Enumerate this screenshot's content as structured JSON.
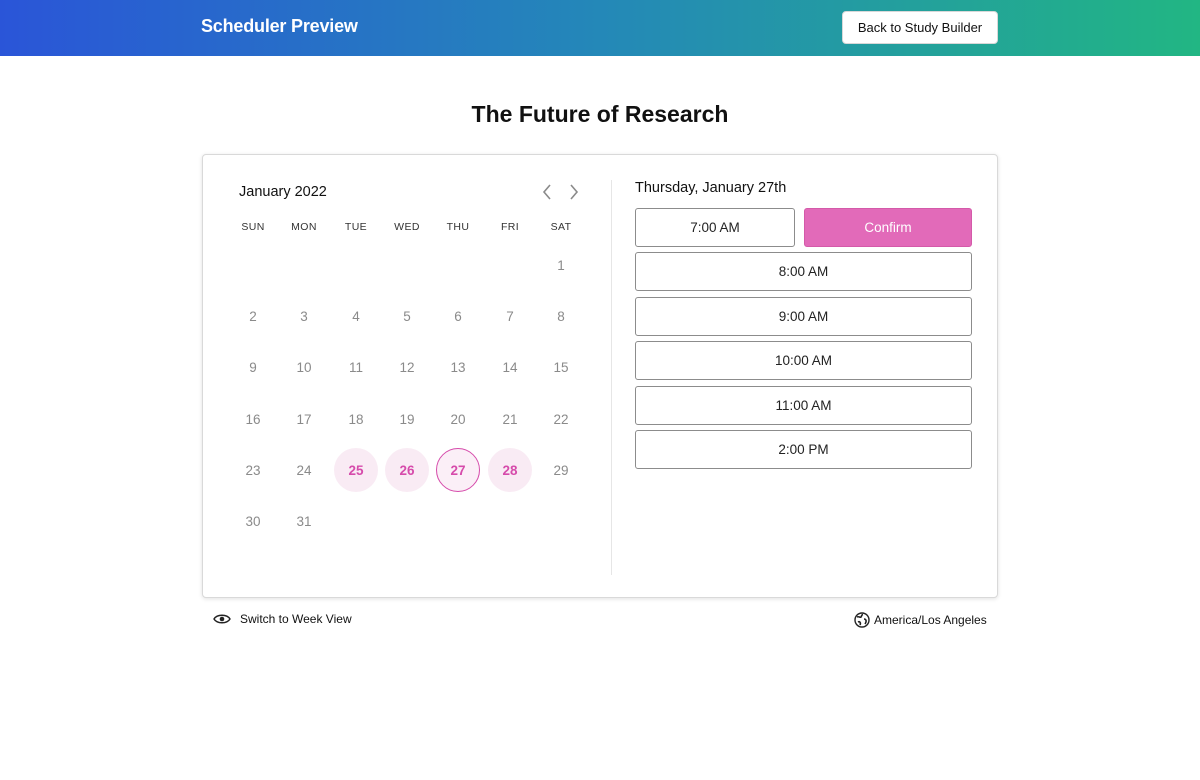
{
  "header": {
    "title": "Scheduler Preview",
    "back_button": "Back to Study Builder"
  },
  "page": {
    "title": "The Future of Research"
  },
  "calendar": {
    "month_label": "January 2022",
    "weekdays": [
      "SUN",
      "MON",
      "TUE",
      "WED",
      "THU",
      "FRI",
      "SAT"
    ],
    "days": [
      "1",
      "2",
      "3",
      "4",
      "5",
      "6",
      "7",
      "8",
      "9",
      "10",
      "11",
      "12",
      "13",
      "14",
      "15",
      "16",
      "17",
      "18",
      "19",
      "20",
      "21",
      "22",
      "23",
      "24",
      "25",
      "26",
      "27",
      "28",
      "29",
      "30",
      "31"
    ],
    "available_days": [
      "25",
      "26",
      "27",
      "28"
    ],
    "selected_day": "27",
    "icons": {
      "prev": "chevron-left-icon",
      "next": "chevron-right-icon"
    }
  },
  "slots": {
    "date_label": "Thursday, January 27th",
    "times": [
      "7:00 AM",
      "8:00 AM",
      "9:00 AM",
      "10:00 AM",
      "11:00 AM",
      "2:00 PM"
    ],
    "selected_time": "7:00 AM",
    "confirm_label": "Confirm"
  },
  "footer": {
    "week_view_label": "Switch to Week View",
    "week_view_icon": "eye-icon",
    "timezone_label": "America/Los Angeles",
    "timezone_icon": "globe-icon"
  },
  "colors": {
    "accent": "#e26ab9",
    "accent_text": "#d64bab",
    "available_bg": "#f9ebf4",
    "header_gradient_start": "#2a55d8",
    "header_gradient_end": "#22b683"
  }
}
